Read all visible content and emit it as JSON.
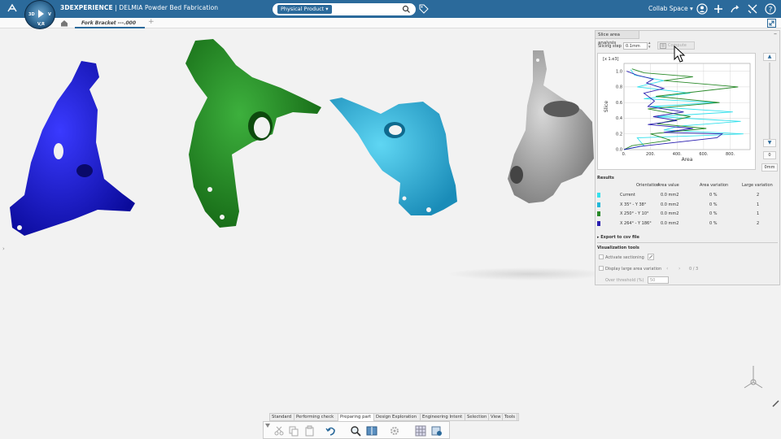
{
  "app": {
    "brand_bold": "3DEXPERIENCE",
    "brand_rest": " | DELMIA Powder Bed Fabrication",
    "compass_left": "3D",
    "compass_right": "V",
    "compass_bottom": "V,R",
    "search_tag": "Physical Product ▾",
    "collab_space": "Collab Space ▾"
  },
  "tabs": {
    "active_tab": "Fork Bracket ---.000",
    "add": "+"
  },
  "panel": {
    "title": "Slice area analysis",
    "slicing_step_label": "Slicing step",
    "slicing_step_value": "0.1mm",
    "compute_label": "Compute",
    "scroll_value": "0",
    "scroll_unit": "0mm",
    "results_label": "Results",
    "columns": [
      "Orientation",
      "Area value",
      "Area variation",
      "Large variation"
    ],
    "rows": [
      {
        "color": "#35e0ec",
        "orientation": "Current",
        "area": "0.0 mm2",
        "variation": "0 %",
        "large": "2"
      },
      {
        "color": "#20b8d8",
        "orientation": "X 35° - Y 38°",
        "area": "0.0 mm2",
        "variation": "0 %",
        "large": "1"
      },
      {
        "color": "#2a8a2a",
        "orientation": "X 250° - Y 10°",
        "area": "0.0 mm2",
        "variation": "0 %",
        "large": "1"
      },
      {
        "color": "#2a1fb0",
        "orientation": "X 264° - Y 186°",
        "area": "0.0 mm2",
        "variation": "0 %",
        "large": "2"
      }
    ],
    "export_label": "Export to csv file",
    "viz_label": "Visualization tools",
    "activate_sectioning": "Activate sectioning",
    "display_large": "Display large area variation",
    "page_count": "0 / 3",
    "over_threshold_label": "Over threshold (%)",
    "over_threshold_value": "50"
  },
  "chart_data": {
    "type": "line",
    "xlabel": "Area",
    "ylabel": "Slice",
    "ymult": "[x 1.e3]",
    "x_ticks": [
      "0.",
      "200.",
      "400.",
      "600.",
      "800."
    ],
    "y_ticks": [
      "0.0",
      "0.2",
      "0.4",
      "0.6",
      "0.8",
      "1.0"
    ],
    "xlim": [
      0,
      950
    ],
    "ylim": [
      0,
      1.1
    ],
    "grid": true,
    "series": [
      {
        "color": "#35e0ec",
        "points": [
          [
            0,
            0
          ],
          [
            150,
            0.05
          ],
          [
            100,
            0.15
          ],
          [
            600,
            0.18
          ],
          [
            900,
            0.2
          ],
          [
            300,
            0.25
          ],
          [
            420,
            0.3
          ],
          [
            880,
            0.36
          ],
          [
            250,
            0.42
          ],
          [
            820,
            0.48
          ],
          [
            200,
            0.55
          ],
          [
            700,
            0.6
          ],
          [
            150,
            0.65
          ],
          [
            500,
            0.72
          ],
          [
            100,
            0.8
          ],
          [
            300,
            0.88
          ],
          [
            80,
            0.95
          ],
          [
            50,
            1.02
          ]
        ]
      },
      {
        "color": "#2a8a2a",
        "points": [
          [
            0,
            0
          ],
          [
            60,
            0.05
          ],
          [
            350,
            0.12
          ],
          [
            200,
            0.2
          ],
          [
            620,
            0.27
          ],
          [
            250,
            0.33
          ],
          [
            500,
            0.42
          ],
          [
            180,
            0.52
          ],
          [
            720,
            0.6
          ],
          [
            240,
            0.68
          ],
          [
            860,
            0.8
          ],
          [
            300,
            0.88
          ],
          [
            520,
            0.93
          ],
          [
            150,
            0.98
          ],
          [
            60,
            1.03
          ]
        ]
      },
      {
        "color": "#2a1fb0",
        "points": [
          [
            0,
            0
          ],
          [
            120,
            0.04
          ],
          [
            700,
            0.15
          ],
          [
            740,
            0.2
          ],
          [
            300,
            0.22
          ],
          [
            520,
            0.27
          ],
          [
            180,
            0.32
          ],
          [
            400,
            0.37
          ],
          [
            220,
            0.42
          ],
          [
            450,
            0.48
          ],
          [
            180,
            0.55
          ],
          [
            230,
            0.62
          ],
          [
            150,
            0.72
          ],
          [
            300,
            0.78
          ],
          [
            170,
            0.85
          ],
          [
            220,
            0.9
          ],
          [
            100,
            0.95
          ],
          [
            20,
            1.0
          ]
        ]
      }
    ]
  },
  "bottom_tabs": [
    "Standard",
    "Performing check",
    "Preparing part",
    "Design Exploration",
    "Engineering Intent",
    "Selection",
    "View",
    "Tools"
  ],
  "bottom_active": "Preparing part"
}
